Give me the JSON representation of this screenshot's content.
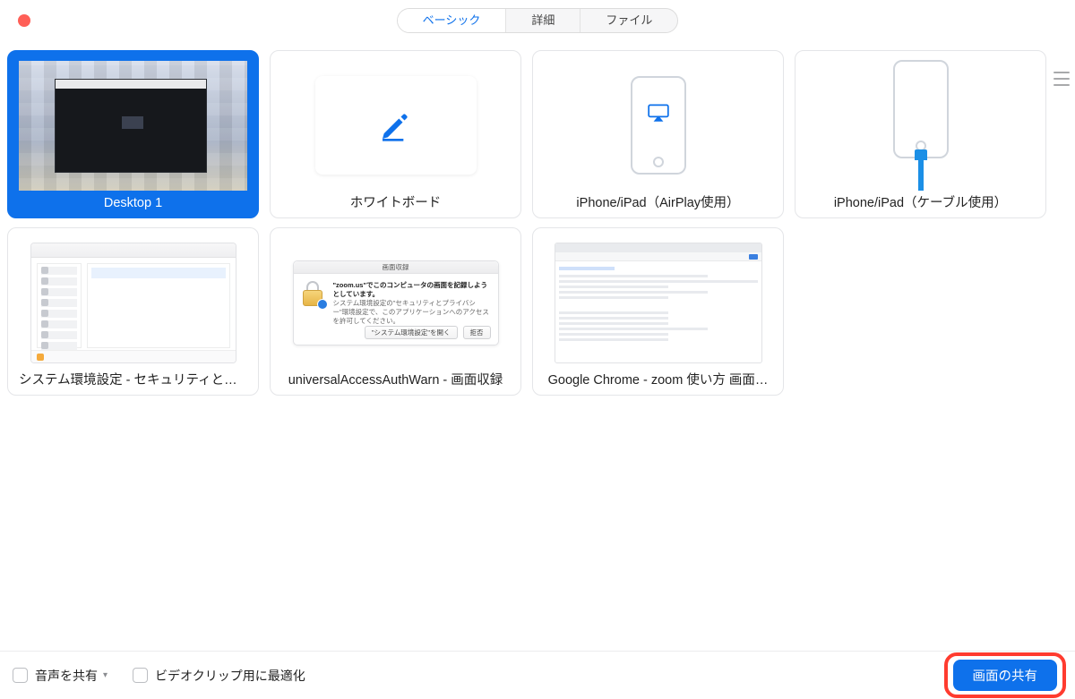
{
  "tabs": {
    "basic": "ベーシック",
    "advanced": "詳細",
    "files": "ファイル"
  },
  "cards": {
    "desktop1": "Desktop 1",
    "whiteboard": "ホワイトボード",
    "airplay": "iPhone/iPad（AirPlay使用）",
    "cable": "iPhone/iPad（ケーブル使用）",
    "syspref": "システム環境設定 - セキュリティとプ…",
    "authwarn": "universalAccessAuthWarn - 画面収録",
    "chrome": "Google Chrome - zoom 使い方 画面…"
  },
  "auth_dialog": {
    "title": "画面収録",
    "line1": "\"zoom.us\"でこのコンピュータの画面を記録しようとしています。",
    "line2": "システム環境設定の\"セキュリティとプライバシー\"環境設定で、このアプリケーションへのアクセスを許可してください。",
    "open_btn": "\"システム環境設定\"を開く",
    "deny_btn": "拒否"
  },
  "bottom": {
    "share_audio": "音声を共有",
    "optimize_video": "ビデオクリップ用に最適化",
    "share_btn": "画面の共有"
  }
}
